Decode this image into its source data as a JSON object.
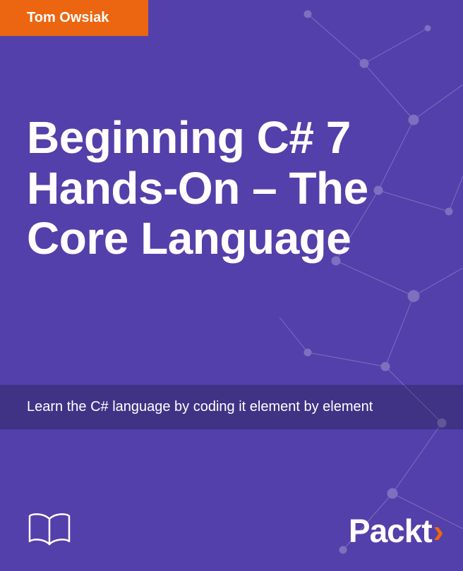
{
  "author": "Tom Owsiak",
  "title": "Beginning C# 7 Hands-On – The Core Language",
  "subtitle": "Learn the C# language by coding it element by element",
  "publisher": "Packt",
  "colors": {
    "background": "#5340aa",
    "accent": "#ec6611"
  }
}
